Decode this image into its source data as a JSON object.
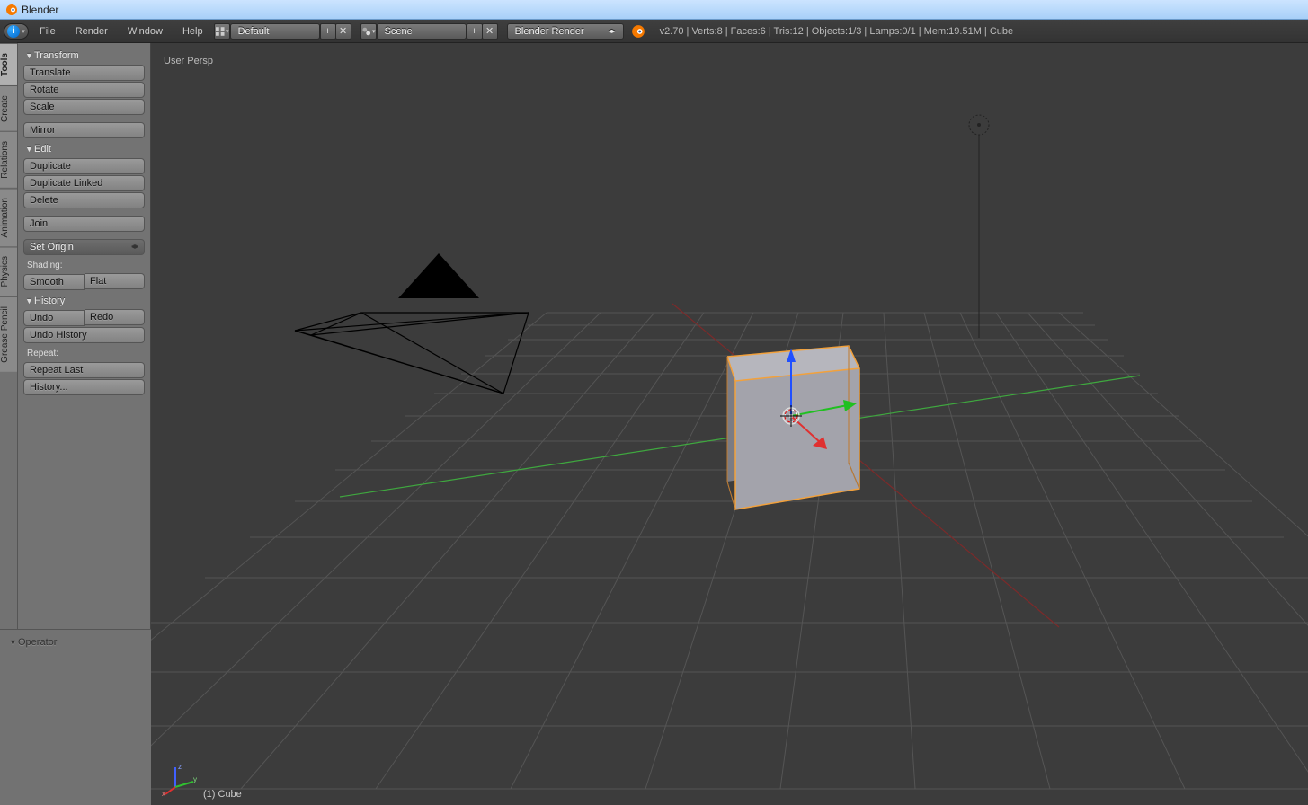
{
  "app": {
    "title": "Blender"
  },
  "menu": {
    "file": "File",
    "render": "Render",
    "window": "Window",
    "help": "Help",
    "layout_name": "Default",
    "scene_name": "Scene",
    "render_engine": "Blender Render",
    "status": "v2.70 | Verts:8 | Faces:6 | Tris:12 | Objects:1/3 | Lamps:0/1 | Mem:19.51M | Cube"
  },
  "vtabs": {
    "tools": "Tools",
    "create": "Create",
    "relations": "Relations",
    "animation": "Animation",
    "physics": "Physics",
    "grease": "Grease Pencil"
  },
  "tools": {
    "transform_header": "Transform",
    "translate": "Translate",
    "rotate": "Rotate",
    "scale": "Scale",
    "mirror": "Mirror",
    "edit_header": "Edit",
    "duplicate": "Duplicate",
    "duplicate_linked": "Duplicate Linked",
    "delete": "Delete",
    "join": "Join",
    "set_origin": "Set Origin",
    "shading_label": "Shading:",
    "smooth": "Smooth",
    "flat": "Flat",
    "history_header": "History",
    "undo": "Undo",
    "redo": "Redo",
    "undo_history": "Undo History",
    "repeat_label": "Repeat:",
    "repeat_last": "Repeat Last",
    "history_menu": "History..."
  },
  "operator": {
    "header": "Operator"
  },
  "viewport": {
    "persp_label": "User Persp",
    "object_label": "(1) Cube"
  }
}
